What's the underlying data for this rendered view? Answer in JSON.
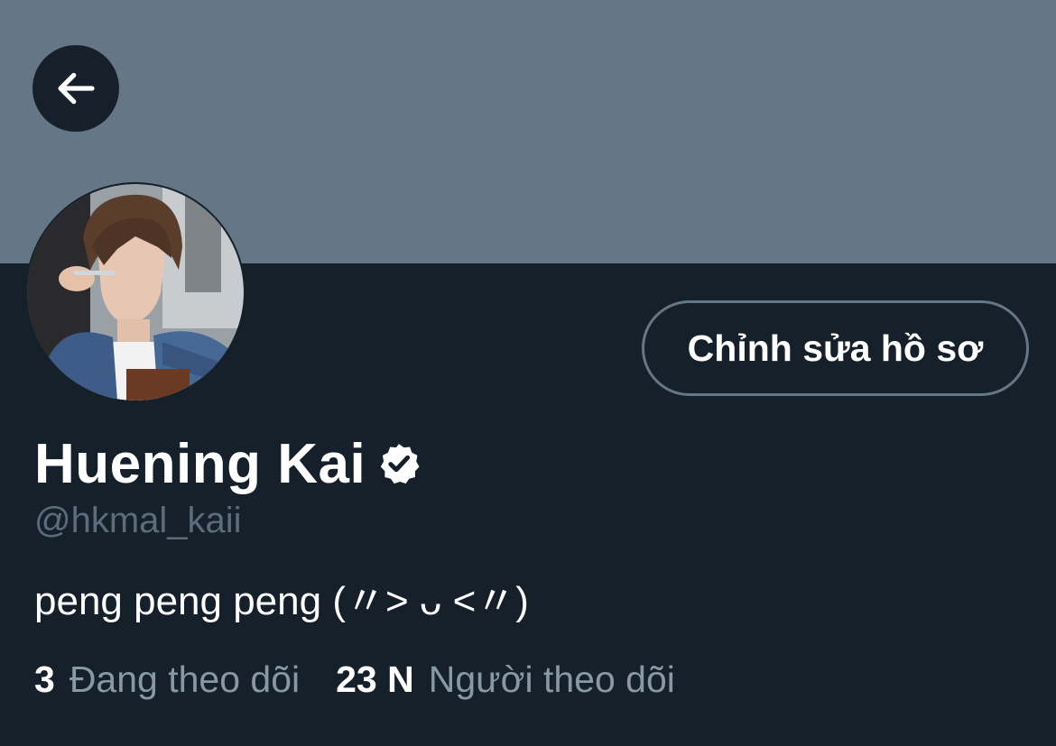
{
  "header": {
    "back_icon": "arrow-left-icon",
    "banner_color": "#657786"
  },
  "profile": {
    "avatar_icon": "profile-photo",
    "edit_button_label": "Chỉnh sửa hồ sơ",
    "display_name": "Huening Kai",
    "verified_icon": "verified-badge-icon",
    "handle": "@hkmal_kaii",
    "bio": "peng peng peng (〃> ᴗ <〃)"
  },
  "stats": {
    "following_count": "3",
    "following_label": "Đang theo dõi",
    "followers_count": "23 N",
    "followers_label": "Người theo dõi"
  },
  "colors": {
    "background": "#15202b",
    "border": "#657786",
    "secondary_text": "#8899a6"
  }
}
